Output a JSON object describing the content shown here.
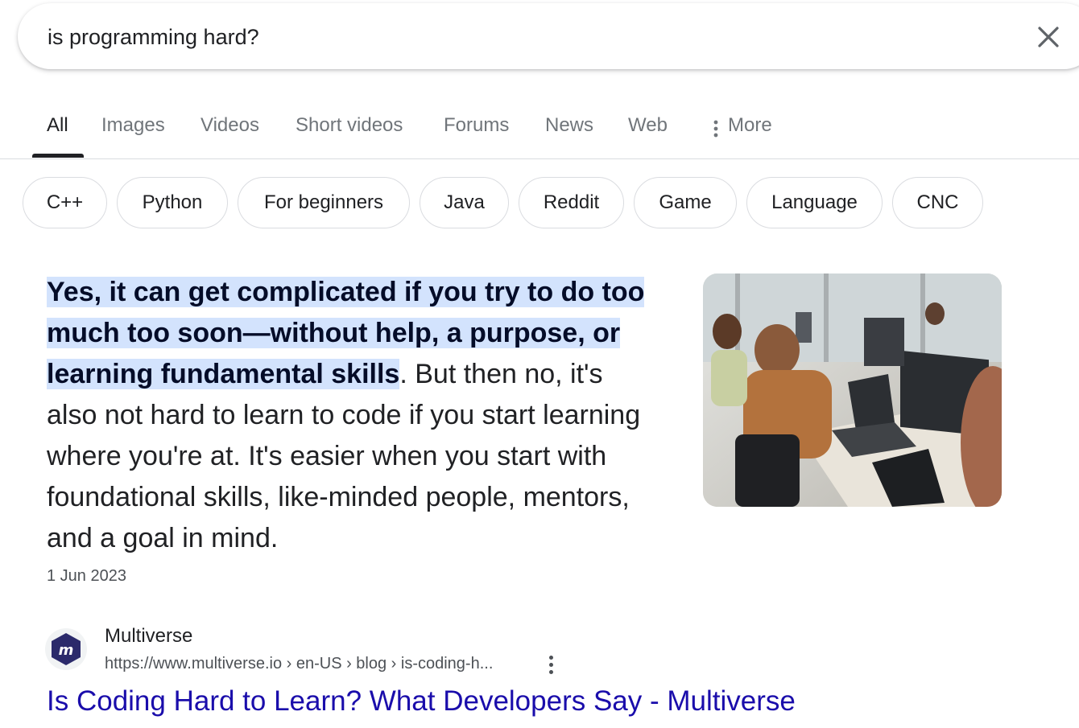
{
  "search": {
    "query": "is programming hard?",
    "clear_icon": "close-icon"
  },
  "tabs": [
    {
      "label": "All",
      "active": true
    },
    {
      "label": "Images"
    },
    {
      "label": "Videos"
    },
    {
      "label": "Short videos"
    },
    {
      "label": "Forums"
    },
    {
      "label": "News"
    },
    {
      "label": "Web"
    },
    {
      "label": "More",
      "icon": "more-vert-icon"
    }
  ],
  "chips": [
    "C++",
    "Python",
    "For beginners",
    "Java",
    "Reddit",
    "Game",
    "Language",
    "CNC"
  ],
  "featured_snippet": {
    "highlight": "Yes, it can get complicated if you try to do too much too soon—without help, a purpose, or learning fundamental skills",
    "rest": ". But then no, it's also not hard to learn to code if you start learning where you're at. It's easier when you start with foundational skills, like-minded people, mentors, and a goal in mind.",
    "date": "1 Jun 2023",
    "image": "office-coding-photo"
  },
  "result": {
    "favicon": "multiverse-logo-icon",
    "source_name": "Multiverse",
    "url": "https://www.multiverse.io › en-US › blog › is-coding-h...",
    "title": "Is Coding Hard to Learn? What Developers Say - Multiverse"
  },
  "colors": {
    "link": "#1a0dab",
    "highlight": "#d3e3fd",
    "muted": "#70757a",
    "border": "#dadce0",
    "favicon_brand": "#2b2a6b"
  }
}
